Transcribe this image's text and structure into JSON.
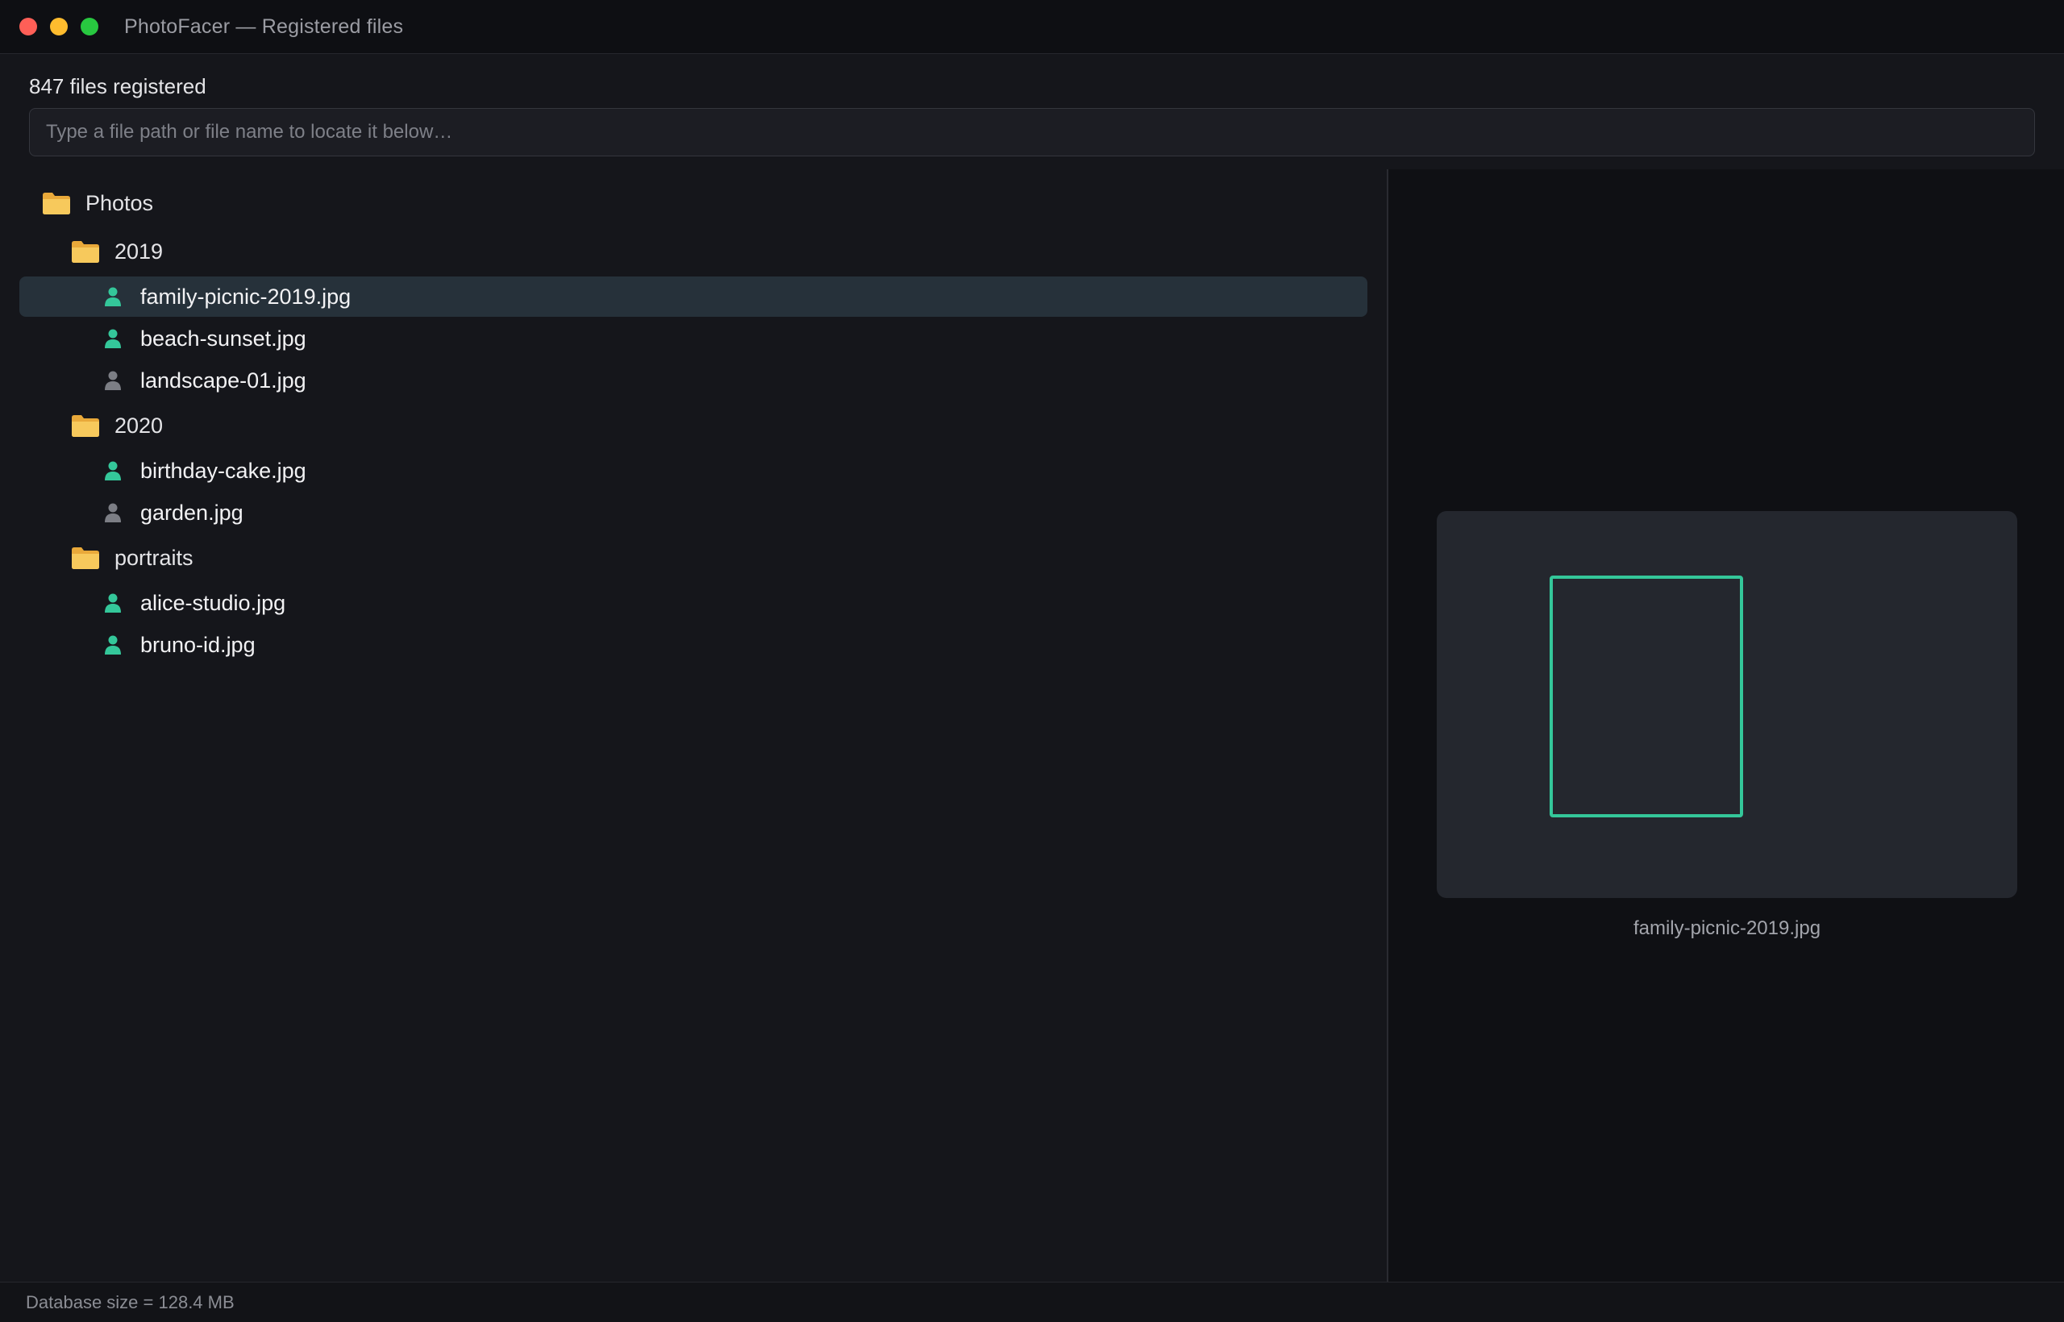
{
  "window": {
    "title": "PhotoFacer — Registered files",
    "controls": [
      "close",
      "minimize",
      "maximize"
    ]
  },
  "header": {
    "file_count_text": "847 files registered",
    "search_placeholder": "Type a file path or file name to locate it below…",
    "search_value": ""
  },
  "tree": {
    "root": {
      "label": "Photos",
      "icon": "folder-icon"
    },
    "folders": [
      {
        "label": "2019",
        "icon": "folder-icon",
        "files": [
          {
            "label": "family-picnic-2019.jpg",
            "has_face": true,
            "selected": true
          },
          {
            "label": "beach-sunset.jpg",
            "has_face": true,
            "selected": false
          },
          {
            "label": "landscape-01.jpg",
            "has_face": false,
            "selected": false
          }
        ]
      },
      {
        "label": "2020",
        "icon": "folder-icon",
        "files": [
          {
            "label": "birthday-cake.jpg",
            "has_face": true,
            "selected": false
          },
          {
            "label": "garden.jpg",
            "has_face": false,
            "selected": false
          }
        ]
      },
      {
        "label": "portraits",
        "icon": "folder-icon",
        "files": [
          {
            "label": "alice-studio.jpg",
            "has_face": true,
            "selected": false
          },
          {
            "label": "bruno-id.jpg",
            "has_face": true,
            "selected": false
          }
        ]
      }
    ]
  },
  "preview": {
    "caption": "family-picnic-2019.jpg",
    "face_box_color": "#34c79a"
  },
  "status": {
    "text": "Database size = 128.4 MB"
  },
  "colors": {
    "face_detected": "#34c79a",
    "no_face": "#7c7e85",
    "folder": "#f4c04a",
    "selected_row": "#26313a"
  }
}
